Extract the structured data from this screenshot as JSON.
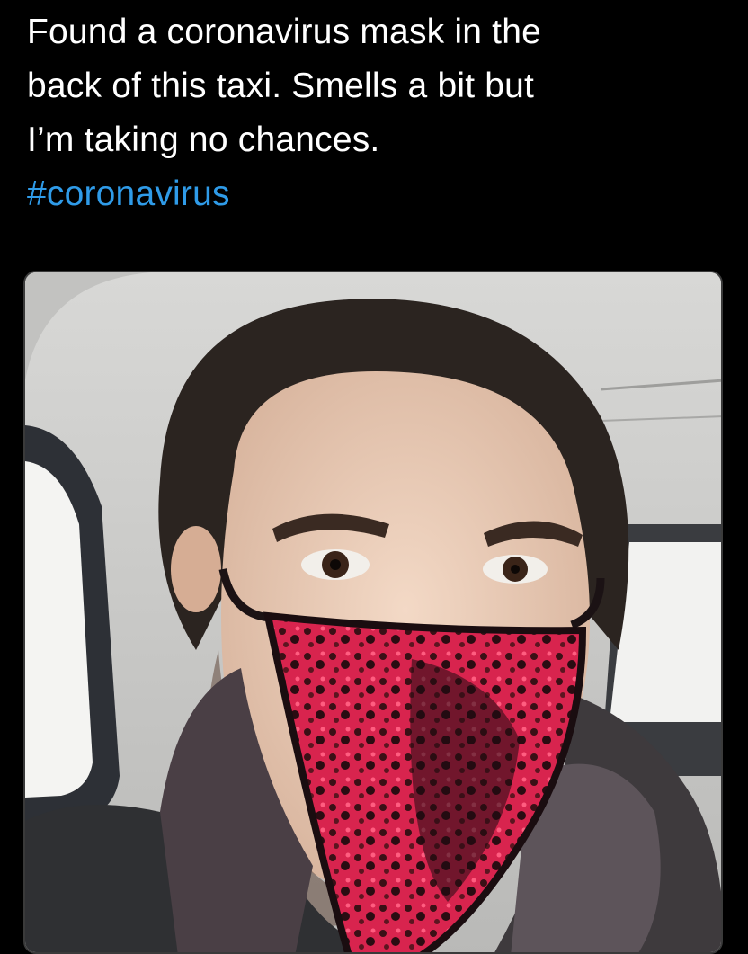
{
  "tweet": {
    "text_lines": [
      "Found a coronavirus mask in the",
      "back of this taxi. Smells a bit but",
      "I’m taking no chances."
    ],
    "hashtag": "#coronavirus"
  },
  "media": {
    "description_icon": "photo-icon"
  },
  "colors": {
    "background": "#000000",
    "text": "#ffffff",
    "hashtag": "#2f9be8"
  }
}
